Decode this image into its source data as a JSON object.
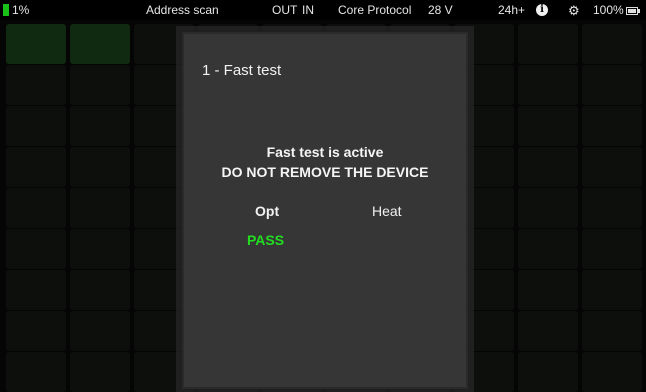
{
  "status_bar": {
    "battery_level": "1%",
    "mode": "Address scan",
    "out": "OUT",
    "in": "IN",
    "protocol": "Core Protocol",
    "voltage": "28 V",
    "time": "24h+",
    "info_glyph": "i",
    "settings_glyph": "⚙",
    "battery_percent": "100%",
    "colors": {
      "level_bar": "#18c018"
    }
  },
  "dialog": {
    "title": "1 - Fast test",
    "heading_line1": "Fast test is active",
    "heading_line2": "DO NOT REMOVE THE DEVICE",
    "tests": [
      {
        "label": "Opt",
        "result": "PASS",
        "result_color": "#22dd22"
      },
      {
        "label": "Heat",
        "result": ""
      }
    ]
  }
}
